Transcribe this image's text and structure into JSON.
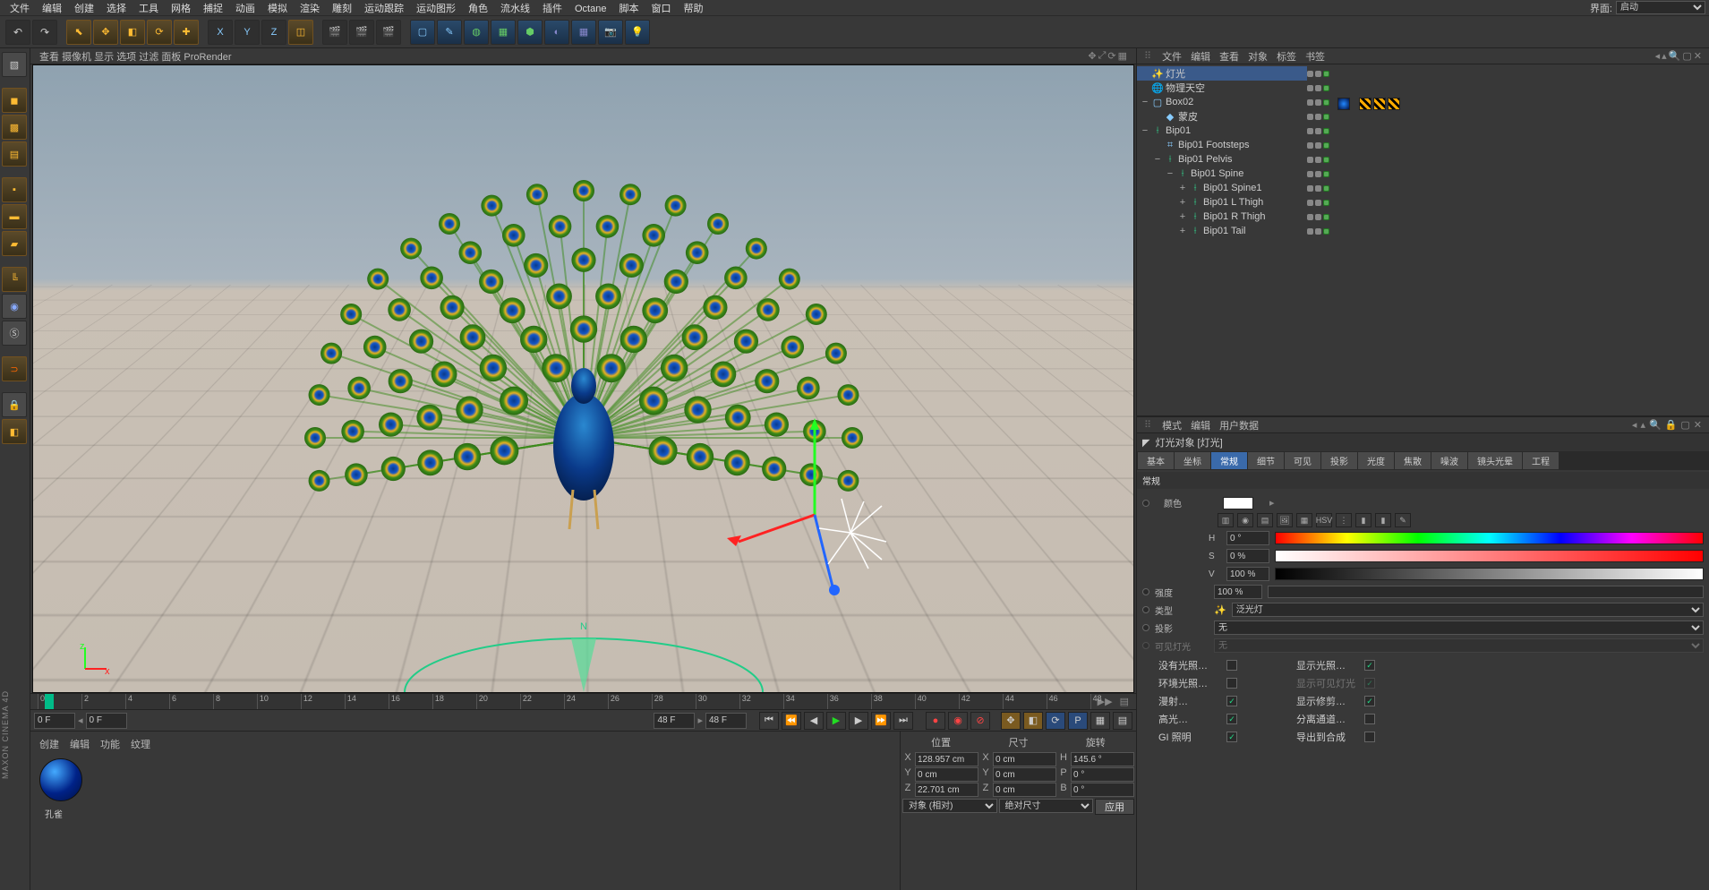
{
  "menubar": {
    "items": [
      "文件",
      "编辑",
      "创建",
      "选择",
      "工具",
      "网格",
      "捕捉",
      "动画",
      "模拟",
      "渲染",
      "雕刻",
      "运动跟踪",
      "运动图形",
      "角色",
      "流水线",
      "插件",
      "Octane",
      "脚本",
      "窗口",
      "帮助"
    ],
    "layout_label": "界面:",
    "layout_value": "启动"
  },
  "viewport_menu": [
    "查看",
    "摄像机",
    "显示",
    "选项",
    "过滤",
    "面板",
    "ProRender"
  ],
  "timeline": {
    "start": 0,
    "end": 48,
    "ticks": [
      0,
      2,
      4,
      6,
      8,
      10,
      12,
      14,
      16,
      18,
      20,
      22,
      24,
      26,
      28,
      30,
      32,
      34,
      36,
      38,
      40,
      42,
      44,
      46,
      48
    ],
    "frame_start_field": "0 F",
    "frame_cur_field": "0 F",
    "frame_end_a": "48 F",
    "frame_end_b": "48 F"
  },
  "material": {
    "tabs": [
      "创建",
      "编辑",
      "功能",
      "纹理"
    ],
    "name": "孔雀"
  },
  "coord": {
    "headers": [
      "位置",
      "尺寸",
      "旋转"
    ],
    "rows": [
      {
        "axis": "X",
        "pos": "128.957 cm",
        "size": "0 cm",
        "rot_lbl": "H",
        "rot": "145.6 °"
      },
      {
        "axis": "Y",
        "pos": "0 cm",
        "size": "0 cm",
        "rot_lbl": "P",
        "rot": "0 °"
      },
      {
        "axis": "Z",
        "pos": "22.701 cm",
        "size": "0 cm",
        "rot_lbl": "B",
        "rot": "0 °"
      }
    ],
    "mode_a": "对象 (相对)",
    "mode_b": "绝对尺寸",
    "apply": "应用"
  },
  "object_panel": {
    "menu": [
      "文件",
      "编辑",
      "查看",
      "对象",
      "标签",
      "书签"
    ],
    "tree": [
      {
        "depth": 0,
        "exp": "",
        "icon": "light",
        "label": "灯光",
        "sel": true
      },
      {
        "depth": 0,
        "exp": "",
        "icon": "sky",
        "label": "物理天空"
      },
      {
        "depth": 0,
        "exp": "−",
        "icon": "cube",
        "label": "Box02"
      },
      {
        "depth": 1,
        "exp": "",
        "icon": "skin",
        "label": "蒙皮"
      },
      {
        "depth": 0,
        "exp": "−",
        "icon": "bone",
        "label": "Bip01"
      },
      {
        "depth": 1,
        "exp": "",
        "icon": "fp",
        "label": "Bip01 Footsteps"
      },
      {
        "depth": 1,
        "exp": "−",
        "icon": "bone",
        "label": "Bip01 Pelvis"
      },
      {
        "depth": 2,
        "exp": "−",
        "icon": "bone",
        "label": "Bip01 Spine"
      },
      {
        "depth": 3,
        "exp": "+",
        "icon": "bone",
        "label": "Bip01 Spine1"
      },
      {
        "depth": 3,
        "exp": "+",
        "icon": "bone",
        "label": "Bip01 L Thigh"
      },
      {
        "depth": 3,
        "exp": "+",
        "icon": "bone",
        "label": "Bip01 R Thigh"
      },
      {
        "depth": 3,
        "exp": "+",
        "icon": "bone",
        "label": "Bip01 Tail"
      }
    ]
  },
  "attr_panel": {
    "menu": [
      "模式",
      "编辑",
      "用户数据"
    ],
    "title": "灯光对象 [灯光]",
    "tabs": [
      "基本",
      "坐标",
      "常规",
      "细节",
      "可见",
      "投影",
      "光度",
      "焦散",
      "噪波",
      "镜头光晕",
      "工程"
    ],
    "active_tab": "常规",
    "section": "常规",
    "color_label": "颜色",
    "h": {
      "lbl": "H",
      "val": "0 °"
    },
    "s": {
      "lbl": "S",
      "val": "0 %"
    },
    "v": {
      "lbl": "V",
      "val": "100 %"
    },
    "intensity": {
      "lbl": "强度",
      "val": "100 %"
    },
    "type": {
      "lbl": "类型",
      "val": "泛光灯"
    },
    "shadow": {
      "lbl": "投影",
      "val": "无"
    },
    "visible_light": {
      "lbl": "可见灯光",
      "val": "无"
    },
    "bools": {
      "no_illum": "没有光照…",
      "show_illum": "显示光照…",
      "ambient": "环境光照…",
      "show_vis": "显示可见灯光",
      "diffuse": "漫射…",
      "show_clip": "显示修剪…",
      "specular": "高光…",
      "sep_pass": "分离通道…",
      "gi": "GI 照明",
      "export_comp": "导出到合成"
    }
  },
  "maxon": "MAXON CINEMA 4D"
}
